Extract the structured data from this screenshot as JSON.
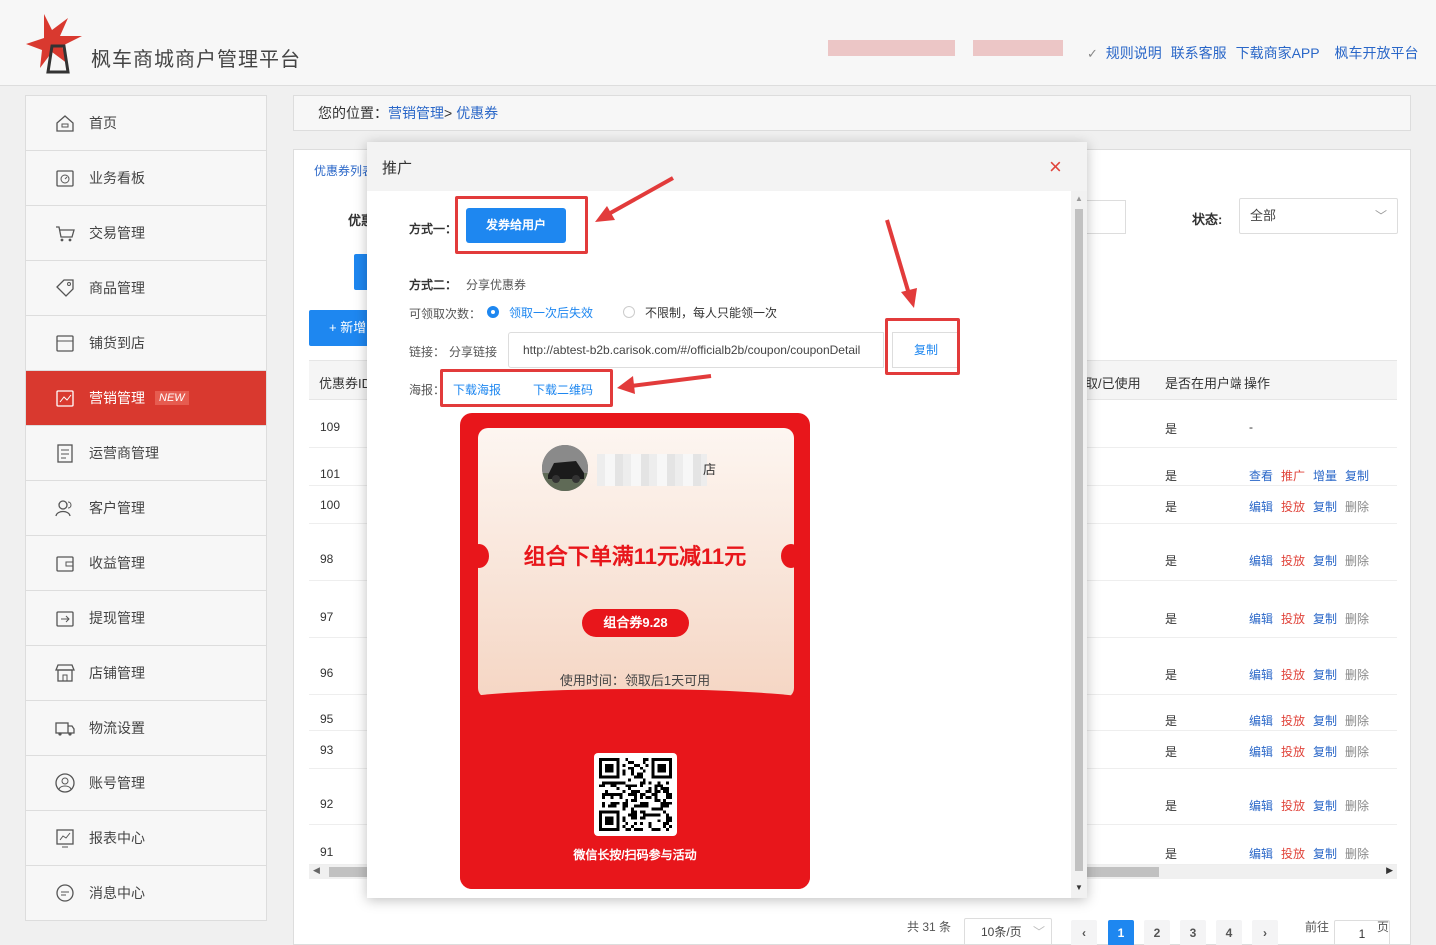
{
  "header": {
    "brand": "枫车商城商户管理平台",
    "links": [
      "规则说明",
      "联系客服",
      "下载商家APP",
      "枫车开放平台"
    ]
  },
  "sidebar": {
    "items": [
      {
        "label": "首页",
        "icon": "home-icon"
      },
      {
        "label": "业务看板",
        "icon": "dashboard-icon"
      },
      {
        "label": "交易管理",
        "icon": "cart-icon"
      },
      {
        "label": "商品管理",
        "icon": "tag-icon"
      },
      {
        "label": "铺货到店",
        "icon": "box-icon"
      },
      {
        "label": "营销管理",
        "icon": "marketing-icon",
        "badge": "NEW"
      },
      {
        "label": "运营商管理",
        "icon": "doc-icon"
      },
      {
        "label": "客户管理",
        "icon": "users-icon"
      },
      {
        "label": "收益管理",
        "icon": "wallet-icon"
      },
      {
        "label": "提现管理",
        "icon": "withdraw-icon"
      },
      {
        "label": "店铺管理",
        "icon": "store-icon"
      },
      {
        "label": "物流设置",
        "icon": "truck-icon"
      },
      {
        "label": "账号管理",
        "icon": "account-icon"
      },
      {
        "label": "报表中心",
        "icon": "report-icon"
      },
      {
        "label": "消息中心",
        "icon": "message-icon"
      }
    ]
  },
  "breadcrumb": {
    "prefix": "您的位置：",
    "l1": "营销管理",
    "sep": ">",
    "l2": "优惠券"
  },
  "main": {
    "tab": "优惠券列表",
    "filter_label": "优惠",
    "status_label": "状态:",
    "status_value": "全部",
    "add_button": "+ 新增",
    "columns": {
      "id": "优惠券ID",
      "used": "取/已使用",
      "shown": "是否在用户端",
      "ops": "操作"
    },
    "rows": [
      {
        "id": "109",
        "shown": "是",
        "ops": [
          "-"
        ]
      },
      {
        "id": "101",
        "shown": "是",
        "ops": [
          "查看",
          "推广",
          "增量",
          "复制"
        ]
      },
      {
        "id": "100",
        "shown": "是",
        "ops": [
          "编辑",
          "投放",
          "复制",
          "删除"
        ]
      },
      {
        "id": "98",
        "shown": "是",
        "ops": [
          "编辑",
          "投放",
          "复制",
          "删除"
        ]
      },
      {
        "id": "97",
        "shown": "是",
        "ops": [
          "编辑",
          "投放",
          "复制",
          "删除"
        ]
      },
      {
        "id": "96",
        "shown": "是",
        "ops": [
          "编辑",
          "投放",
          "复制",
          "删除"
        ]
      },
      {
        "id": "95",
        "shown": "是",
        "ops": [
          "编辑",
          "投放",
          "复制",
          "删除"
        ]
      },
      {
        "id": "93",
        "shown": "是",
        "ops": [
          "编辑",
          "投放",
          "复制",
          "删除"
        ]
      },
      {
        "id": "92",
        "shown": "是",
        "ops": [
          "编辑",
          "投放",
          "复制",
          "删除"
        ]
      },
      {
        "id": "91",
        "shown": "是",
        "ops": [
          "编辑",
          "投放",
          "复制",
          "删除"
        ]
      }
    ]
  },
  "pagination": {
    "total": "共 31 条",
    "page_size": "10条/页",
    "pages": [
      "1",
      "2",
      "3",
      "4"
    ],
    "prev": "‹",
    "next": "›",
    "goto_label": "前往",
    "goto_value": "1",
    "goto_suffix": "页"
  },
  "modal": {
    "title": "推广",
    "close": "×",
    "method1_label": "方式一：",
    "send_button": "发券给用户",
    "method2_label": "方式二：",
    "method2_text": "分享优惠券",
    "count_label": "可领取次数：",
    "option1": "领取一次后失效",
    "option2": "不限制，每人只能领一次",
    "link_label": "链接：",
    "link_prefix": "分享链接",
    "link_value": "http://abtest-b2b.carisok.com/#/officialb2b/coupon/couponDetail",
    "copy_button": "复制",
    "poster_label": "海报：",
    "download_poster": "下载海报",
    "download_qr": "下载二维码"
  },
  "poster": {
    "shop_suffix": "店",
    "title": "组合下单满11元减11元",
    "pill": "组合券9.28",
    "time": "使用时间：领取后1天可用",
    "caption": "微信长按/扫码参与活动"
  },
  "colors": {
    "brand_red": "#e8161b",
    "primary_blue": "#1e87f0",
    "sidebar_active": "#d9392f",
    "highlight": "#e23b3b"
  }
}
